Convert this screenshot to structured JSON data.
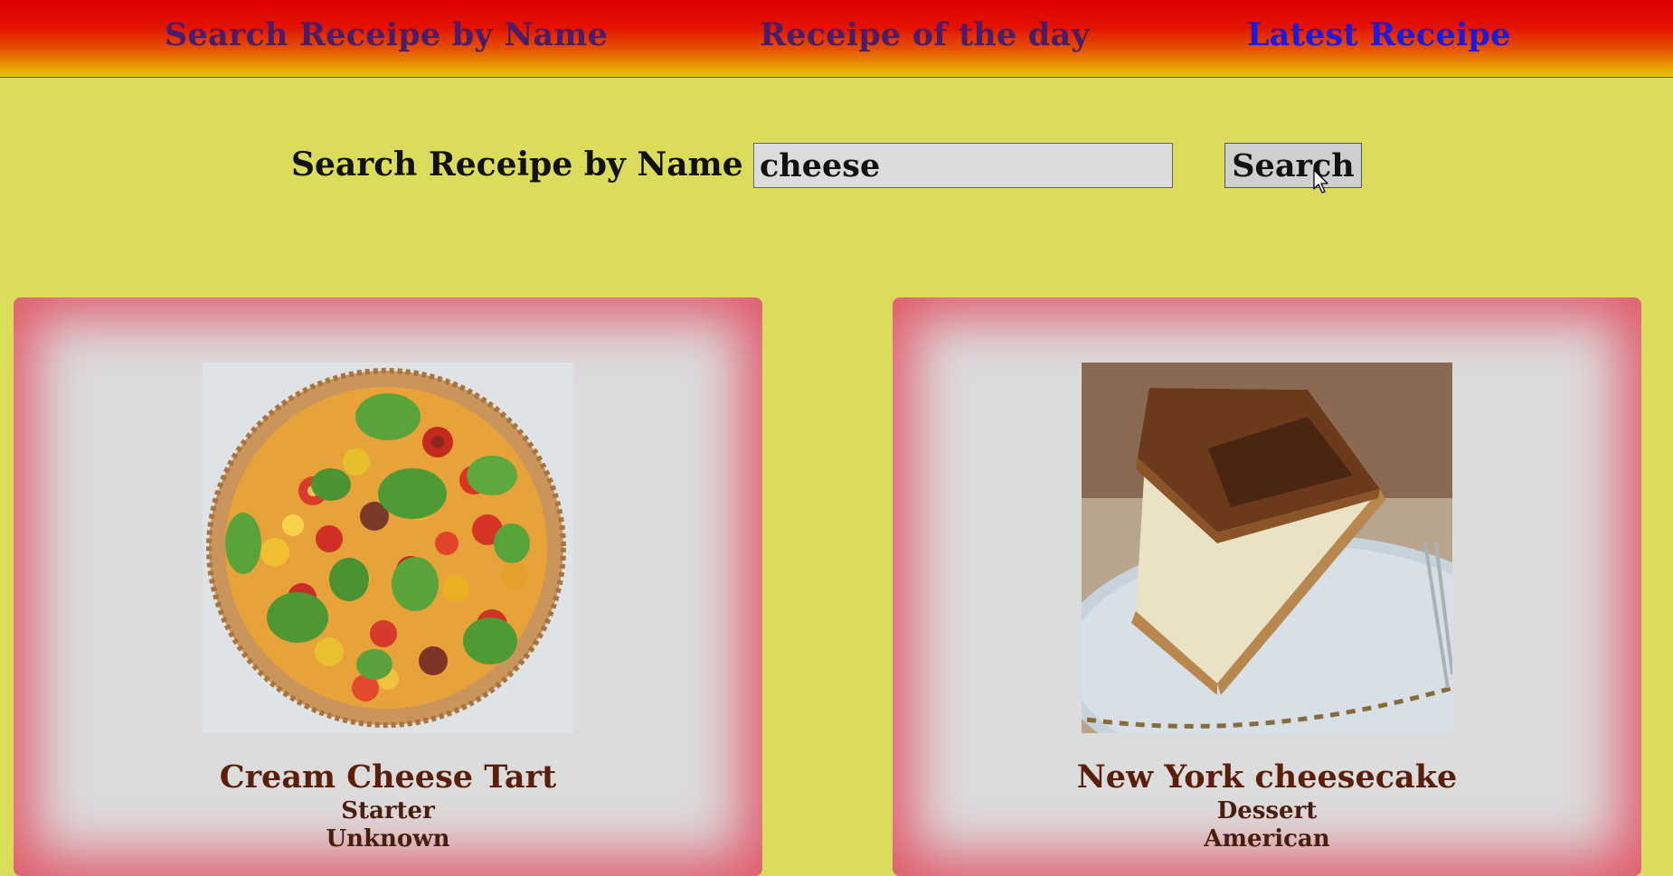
{
  "nav": {
    "items": [
      {
        "label": "Search Receipe by Name"
      },
      {
        "label": "Receipe of the day"
      },
      {
        "label": "Latest Receipe"
      }
    ]
  },
  "search": {
    "label": "Search Receipe by Name",
    "value": "cheese",
    "button_label": "Search"
  },
  "results": [
    {
      "title": "Cream Cheese Tart",
      "course": "Starter",
      "cuisine": "Unknown"
    },
    {
      "title": "New York cheesecake",
      "course": "Dessert",
      "cuisine": "American"
    }
  ],
  "colors": {
    "page_background": "#dbdb5c",
    "nav_link": "#4a1c6a",
    "nav_link_active": "#1a1ae0",
    "card_glow": "#e05a6a",
    "card_title": "#5a1e0a"
  }
}
